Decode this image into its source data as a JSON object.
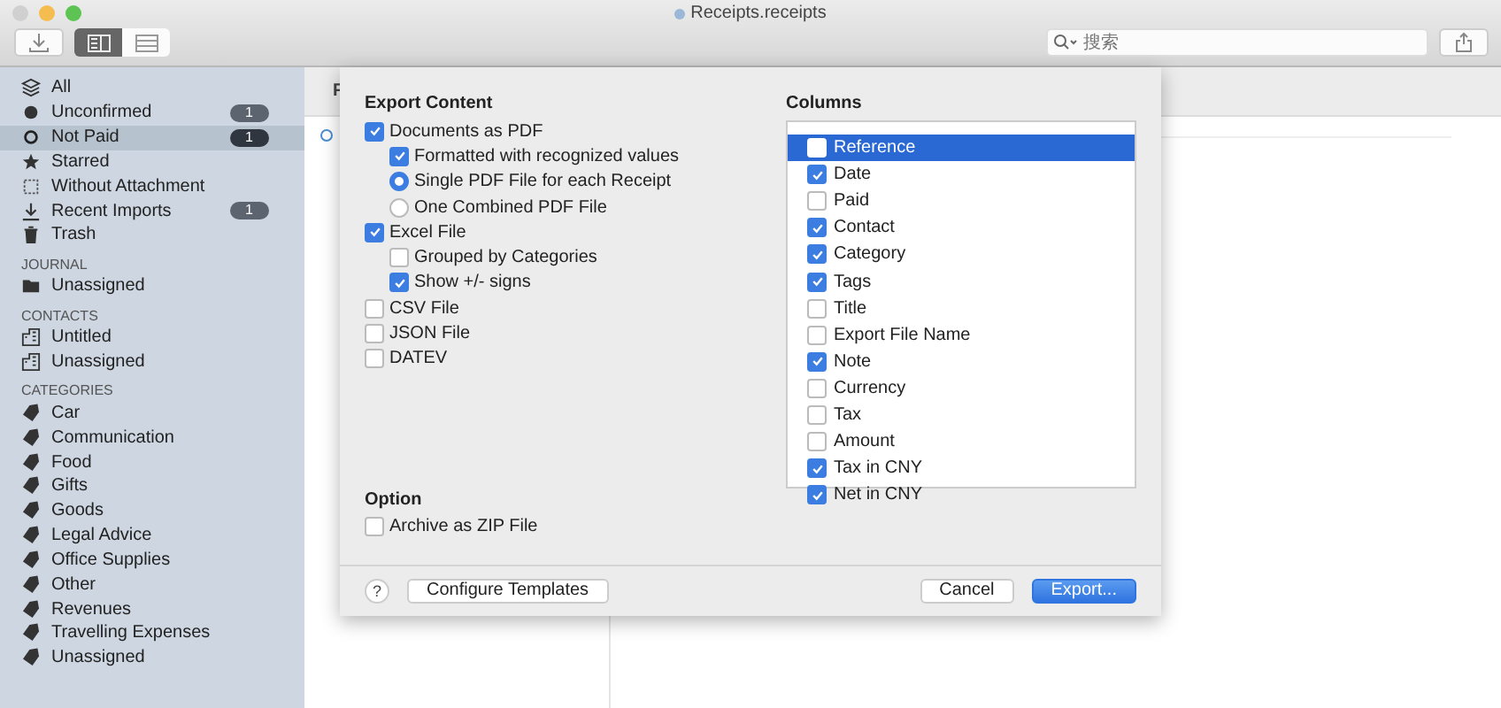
{
  "window": {
    "title": "Receipts.receipts"
  },
  "toolbar": {
    "view_modes": [
      {
        "selected": true
      },
      {
        "selected": false
      }
    ],
    "search": {
      "placeholder": "搜索"
    }
  },
  "sidebar": {
    "sections": [
      {
        "items": [
          {
            "label": "All",
            "selected": false
          },
          {
            "label": "Unconfirmed",
            "badge": "1",
            "selected": false
          },
          {
            "label": "Not Paid",
            "badge": "1",
            "selected": true
          },
          {
            "label": "Starred",
            "selected": false
          },
          {
            "label": "Without Attachment",
            "selected": false
          },
          {
            "label": "Recent Imports",
            "badge": "1",
            "selected": false
          },
          {
            "label": "Trash",
            "selected": false
          }
        ]
      },
      {
        "heading": "JOURNAL",
        "items": [
          {
            "label": "Unassigned",
            "selected": false
          }
        ]
      },
      {
        "heading": "CONTACTS",
        "items": [
          {
            "label": "Untitled",
            "selected": false
          },
          {
            "label": "Unassigned",
            "selected": false
          }
        ]
      },
      {
        "heading": "CATEGORIES",
        "items": [
          {
            "label": "Car",
            "selected": false
          },
          {
            "label": "Communication",
            "selected": false
          },
          {
            "label": "Food",
            "selected": false
          },
          {
            "label": "Gifts",
            "selected": false
          },
          {
            "label": "Goods",
            "selected": false
          },
          {
            "label": "Legal Advice",
            "selected": false
          },
          {
            "label": "Office Supplies",
            "selected": false
          },
          {
            "label": "Other",
            "selected": false
          },
          {
            "label": "Revenues",
            "selected": false
          },
          {
            "label": "Travelling Expenses",
            "selected": false
          },
          {
            "label": "Unassigned",
            "selected": false
          }
        ]
      }
    ]
  },
  "list": {
    "column_1": "F"
  },
  "dialog": {
    "export_heading": "Export Content",
    "export_options": [
      {
        "kind": "checkbox",
        "label": "Documents as PDF",
        "checked": true,
        "children": [
          {
            "kind": "checkbox",
            "label": "Formatted with recognized values",
            "checked": true
          },
          {
            "kind": "radio",
            "label": "Single PDF File for each Receipt",
            "selected": true
          },
          {
            "kind": "radio",
            "label": "One Combined PDF File",
            "selected": false
          }
        ]
      },
      {
        "kind": "checkbox",
        "label": "Excel File",
        "checked": true,
        "children": [
          {
            "kind": "checkbox",
            "label": "Grouped by Categories",
            "checked": false
          },
          {
            "kind": "checkbox",
            "label": "Show +/- signs",
            "checked": true
          }
        ]
      },
      {
        "kind": "checkbox",
        "label": "CSV File",
        "checked": false
      },
      {
        "kind": "checkbox",
        "label": "JSON File",
        "checked": false
      },
      {
        "kind": "checkbox",
        "label": "DATEV",
        "checked": false
      }
    ],
    "option_heading": "Option",
    "options": [
      {
        "label": "Archive as ZIP File",
        "checked": false
      }
    ],
    "columns_heading": "Columns",
    "columns": [
      {
        "label": "Reference",
        "checked": false,
        "selected": true
      },
      {
        "label": "Date",
        "checked": true,
        "selected": false
      },
      {
        "label": "Paid",
        "checked": false,
        "selected": false
      },
      {
        "label": "Contact",
        "checked": true,
        "selected": false
      },
      {
        "label": "Category",
        "checked": true,
        "selected": false
      },
      {
        "label": "Tags",
        "checked": true,
        "selected": false
      },
      {
        "label": "Title",
        "checked": false,
        "selected": false
      },
      {
        "label": "Export File Name",
        "checked": false,
        "selected": false
      },
      {
        "label": "Note",
        "checked": true,
        "selected": false
      },
      {
        "label": "Currency",
        "checked": false,
        "selected": false
      },
      {
        "label": "Tax",
        "checked": false,
        "selected": false
      },
      {
        "label": "Amount",
        "checked": false,
        "selected": false
      },
      {
        "label": "Tax in CNY",
        "checked": true,
        "selected": false
      },
      {
        "label": "Net in CNY",
        "checked": true,
        "selected": false
      }
    ],
    "help": "?",
    "buttons": [
      {
        "kind": "secondary",
        "label": "Configure Templates"
      },
      {
        "kind": "secondary",
        "label": "Cancel"
      },
      {
        "kind": "primary",
        "label": "Export..."
      }
    ]
  }
}
